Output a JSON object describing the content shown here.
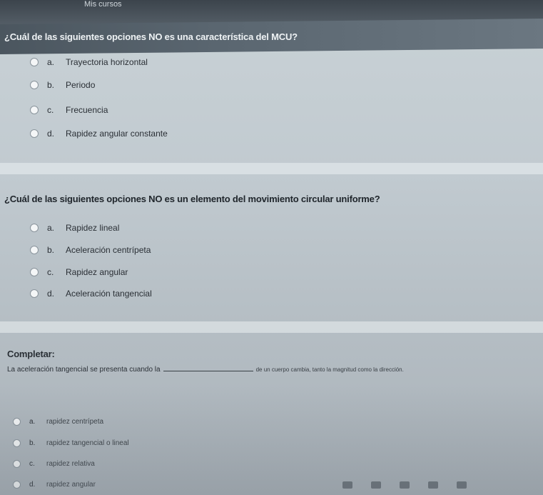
{
  "breadcrumb": "Mis cursos",
  "questions": [
    {
      "text": "¿Cuál de las siguientes opciones NO es una característica del MCU?",
      "options": [
        {
          "letter": "a.",
          "label": "Trayectoria horizontal"
        },
        {
          "letter": "b.",
          "label": "Periodo"
        },
        {
          "letter": "c.",
          "label": "Frecuencia"
        },
        {
          "letter": "d.",
          "label": "Rapidez angular constante"
        }
      ]
    },
    {
      "text": "¿Cuál de las siguientes opciones NO es un elemento del movimiento circular uniforme?",
      "options": [
        {
          "letter": "a.",
          "label": "Rapidez lineal"
        },
        {
          "letter": "b.",
          "label": "Aceleración centrípeta"
        },
        {
          "letter": "c.",
          "label": "Rapidez angular"
        },
        {
          "letter": "d.",
          "label": "Aceleración tangencial"
        }
      ]
    },
    {
      "title": "Completar:",
      "sentence_start": "La aceleración tangencial se presenta cuando la",
      "sentence_end": "de un cuerpo cambia, tanto la magnitud como la dirección.",
      "options": [
        {
          "letter": "a.",
          "label": "rapidez centrípeta"
        },
        {
          "letter": "b.",
          "label": "rapidez tangencial o lineal"
        },
        {
          "letter": "c.",
          "label": "rapidez relativa"
        },
        {
          "letter": "d.",
          "label": "rapidez angular"
        }
      ]
    }
  ],
  "colors": {
    "header_dark": "#4b565f",
    "background": "#c1cad0",
    "radio_fill": "#f4f6f7"
  }
}
